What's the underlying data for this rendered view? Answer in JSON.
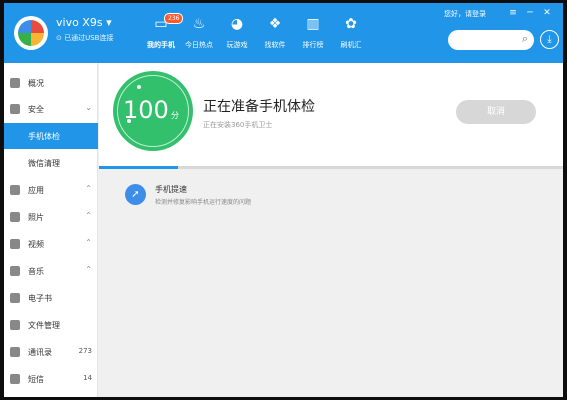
{
  "header": {
    "device_name": "vivo X9s ▾",
    "device_sub": "已通过USB连接",
    "login_text": "您好，请登录",
    "nav": [
      {
        "label": "我的手机",
        "icon": "phone-icon",
        "badge": "236"
      },
      {
        "label": "今日热点",
        "icon": "fire-icon"
      },
      {
        "label": "玩游戏",
        "icon": "gamepad-icon"
      },
      {
        "label": "找软件",
        "icon": "apps-icon"
      },
      {
        "label": "排行榜",
        "icon": "ranking-icon"
      },
      {
        "label": "刷机汇",
        "icon": "flash-icon"
      }
    ],
    "search": {
      "placeholder": ""
    }
  },
  "sidebar": {
    "items": [
      {
        "label": "概况",
        "icon": "home-icon"
      },
      {
        "label": "安全",
        "icon": "shield-icon"
      },
      {
        "label": "手机体检"
      },
      {
        "label": "微信清理"
      },
      {
        "label": "应用",
        "icon": "apps-icon"
      },
      {
        "label": "照片",
        "icon": "photo-icon"
      },
      {
        "label": "视频",
        "icon": "video-icon"
      },
      {
        "label": "音乐",
        "icon": "music-icon"
      },
      {
        "label": "电子书",
        "icon": "book-icon"
      },
      {
        "label": "文件管理",
        "icon": "folder-icon"
      },
      {
        "label": "通讯录",
        "icon": "contacts-icon",
        "count": "273"
      },
      {
        "label": "短信",
        "icon": "sms-icon",
        "count": "14"
      }
    ]
  },
  "checkup": {
    "score": "100",
    "score_unit": "分",
    "title": "正在准备手机体检",
    "subtitle": "正在安装360手机卫士",
    "cancel_label": "取消",
    "progress": 0.17
  },
  "tip": {
    "title": "手机提速",
    "subtitle": "检测并修复影响手机运行速度的问题"
  },
  "colors": {
    "primary": "#2196e8",
    "gauge": "#33c06d",
    "badge": "#ff5a2c"
  }
}
